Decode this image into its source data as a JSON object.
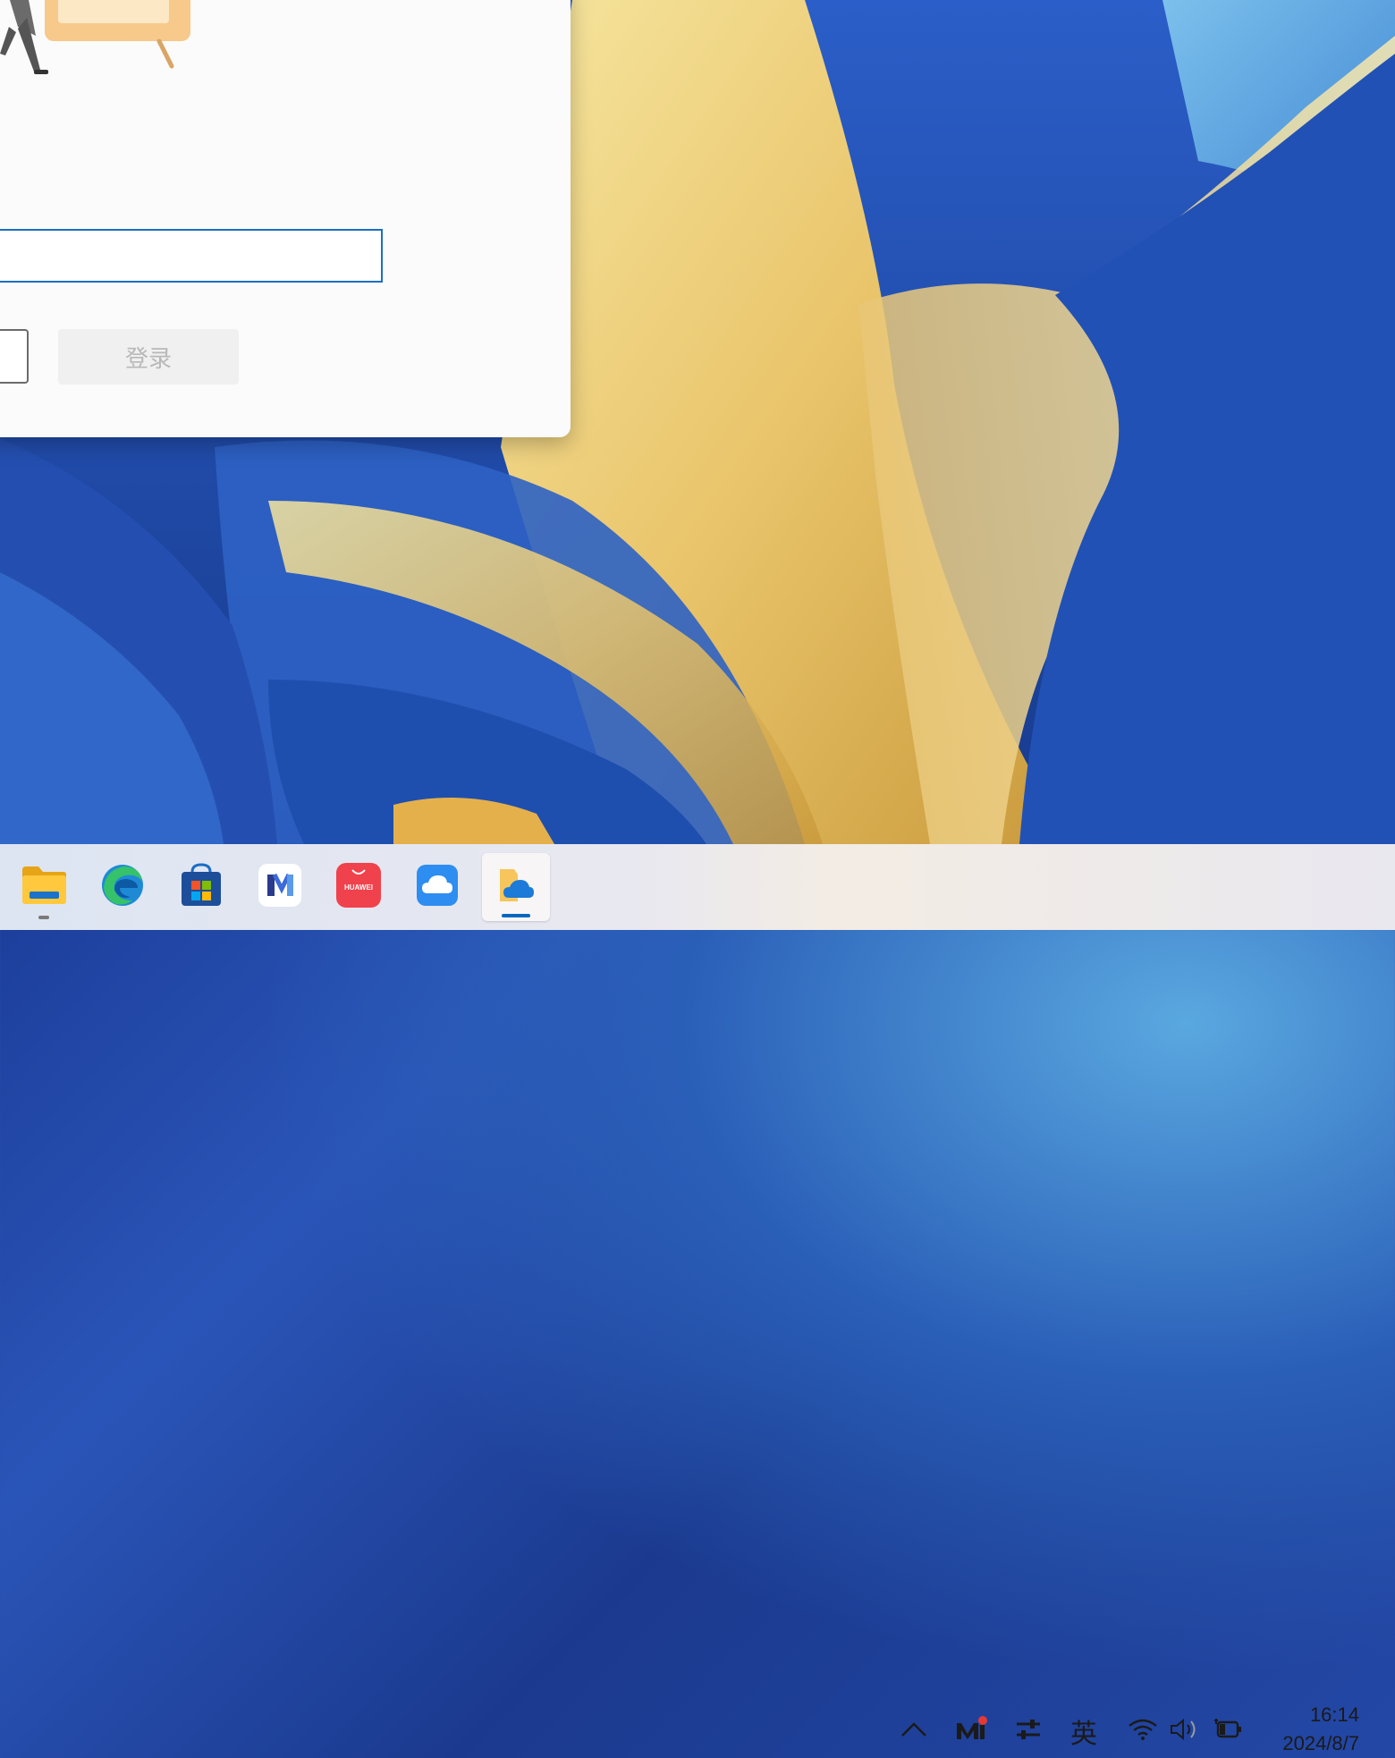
{
  "dialog": {
    "login_button": "登录"
  },
  "taskbar": {
    "apps": [
      {
        "name": "File Explorer",
        "icon": "folder-icon"
      },
      {
        "name": "Microsoft Edge",
        "icon": "edge-icon"
      },
      {
        "name": "Microsoft Store",
        "icon": "store-icon"
      },
      {
        "name": "HUAWEI PC Manager",
        "icon": "pc-manager-icon"
      },
      {
        "name": "HUAWEI AppGallery",
        "icon": "appgallery-icon",
        "label": "HUAWEI"
      },
      {
        "name": "Cloud",
        "icon": "cloud-icon"
      },
      {
        "name": "OneDrive",
        "icon": "onedrive-icon"
      }
    ],
    "tray": {
      "ime": "英",
      "time": "16:14",
      "date": "2024/8/7"
    }
  },
  "colors": {
    "accent": "#1a6fc0",
    "active_indicator": "#0067c0"
  }
}
